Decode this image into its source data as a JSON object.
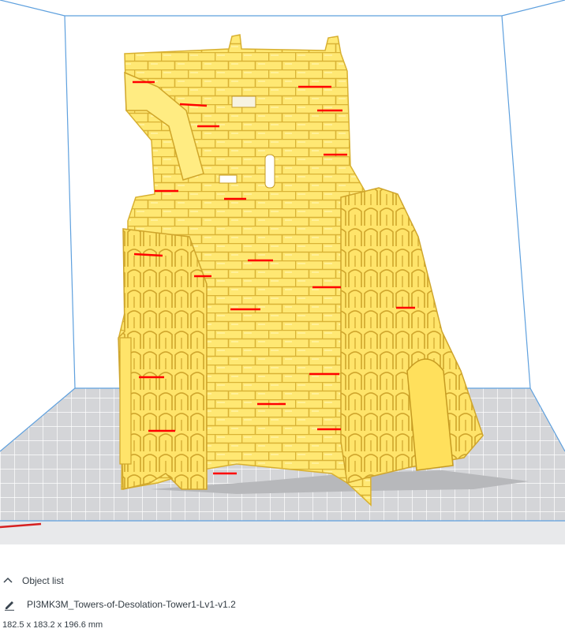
{
  "app": {
    "accent_color": "#5ea0de",
    "model_color": "#ffe56b",
    "build_plate_color": "#d2d3d6"
  },
  "viewport": {
    "view": "front",
    "overhang_color": "#ff0000"
  },
  "object_list": {
    "header_label": "Object list",
    "collapse_icon": "chevron-up-icon",
    "edit_icon": "pencil-icon",
    "object_name": "PI3MK3M_Towers-of-Desolation-Tower1-Lv1-v1.2",
    "dimensions": "182.5 x 183.2 x 196.6 mm"
  }
}
